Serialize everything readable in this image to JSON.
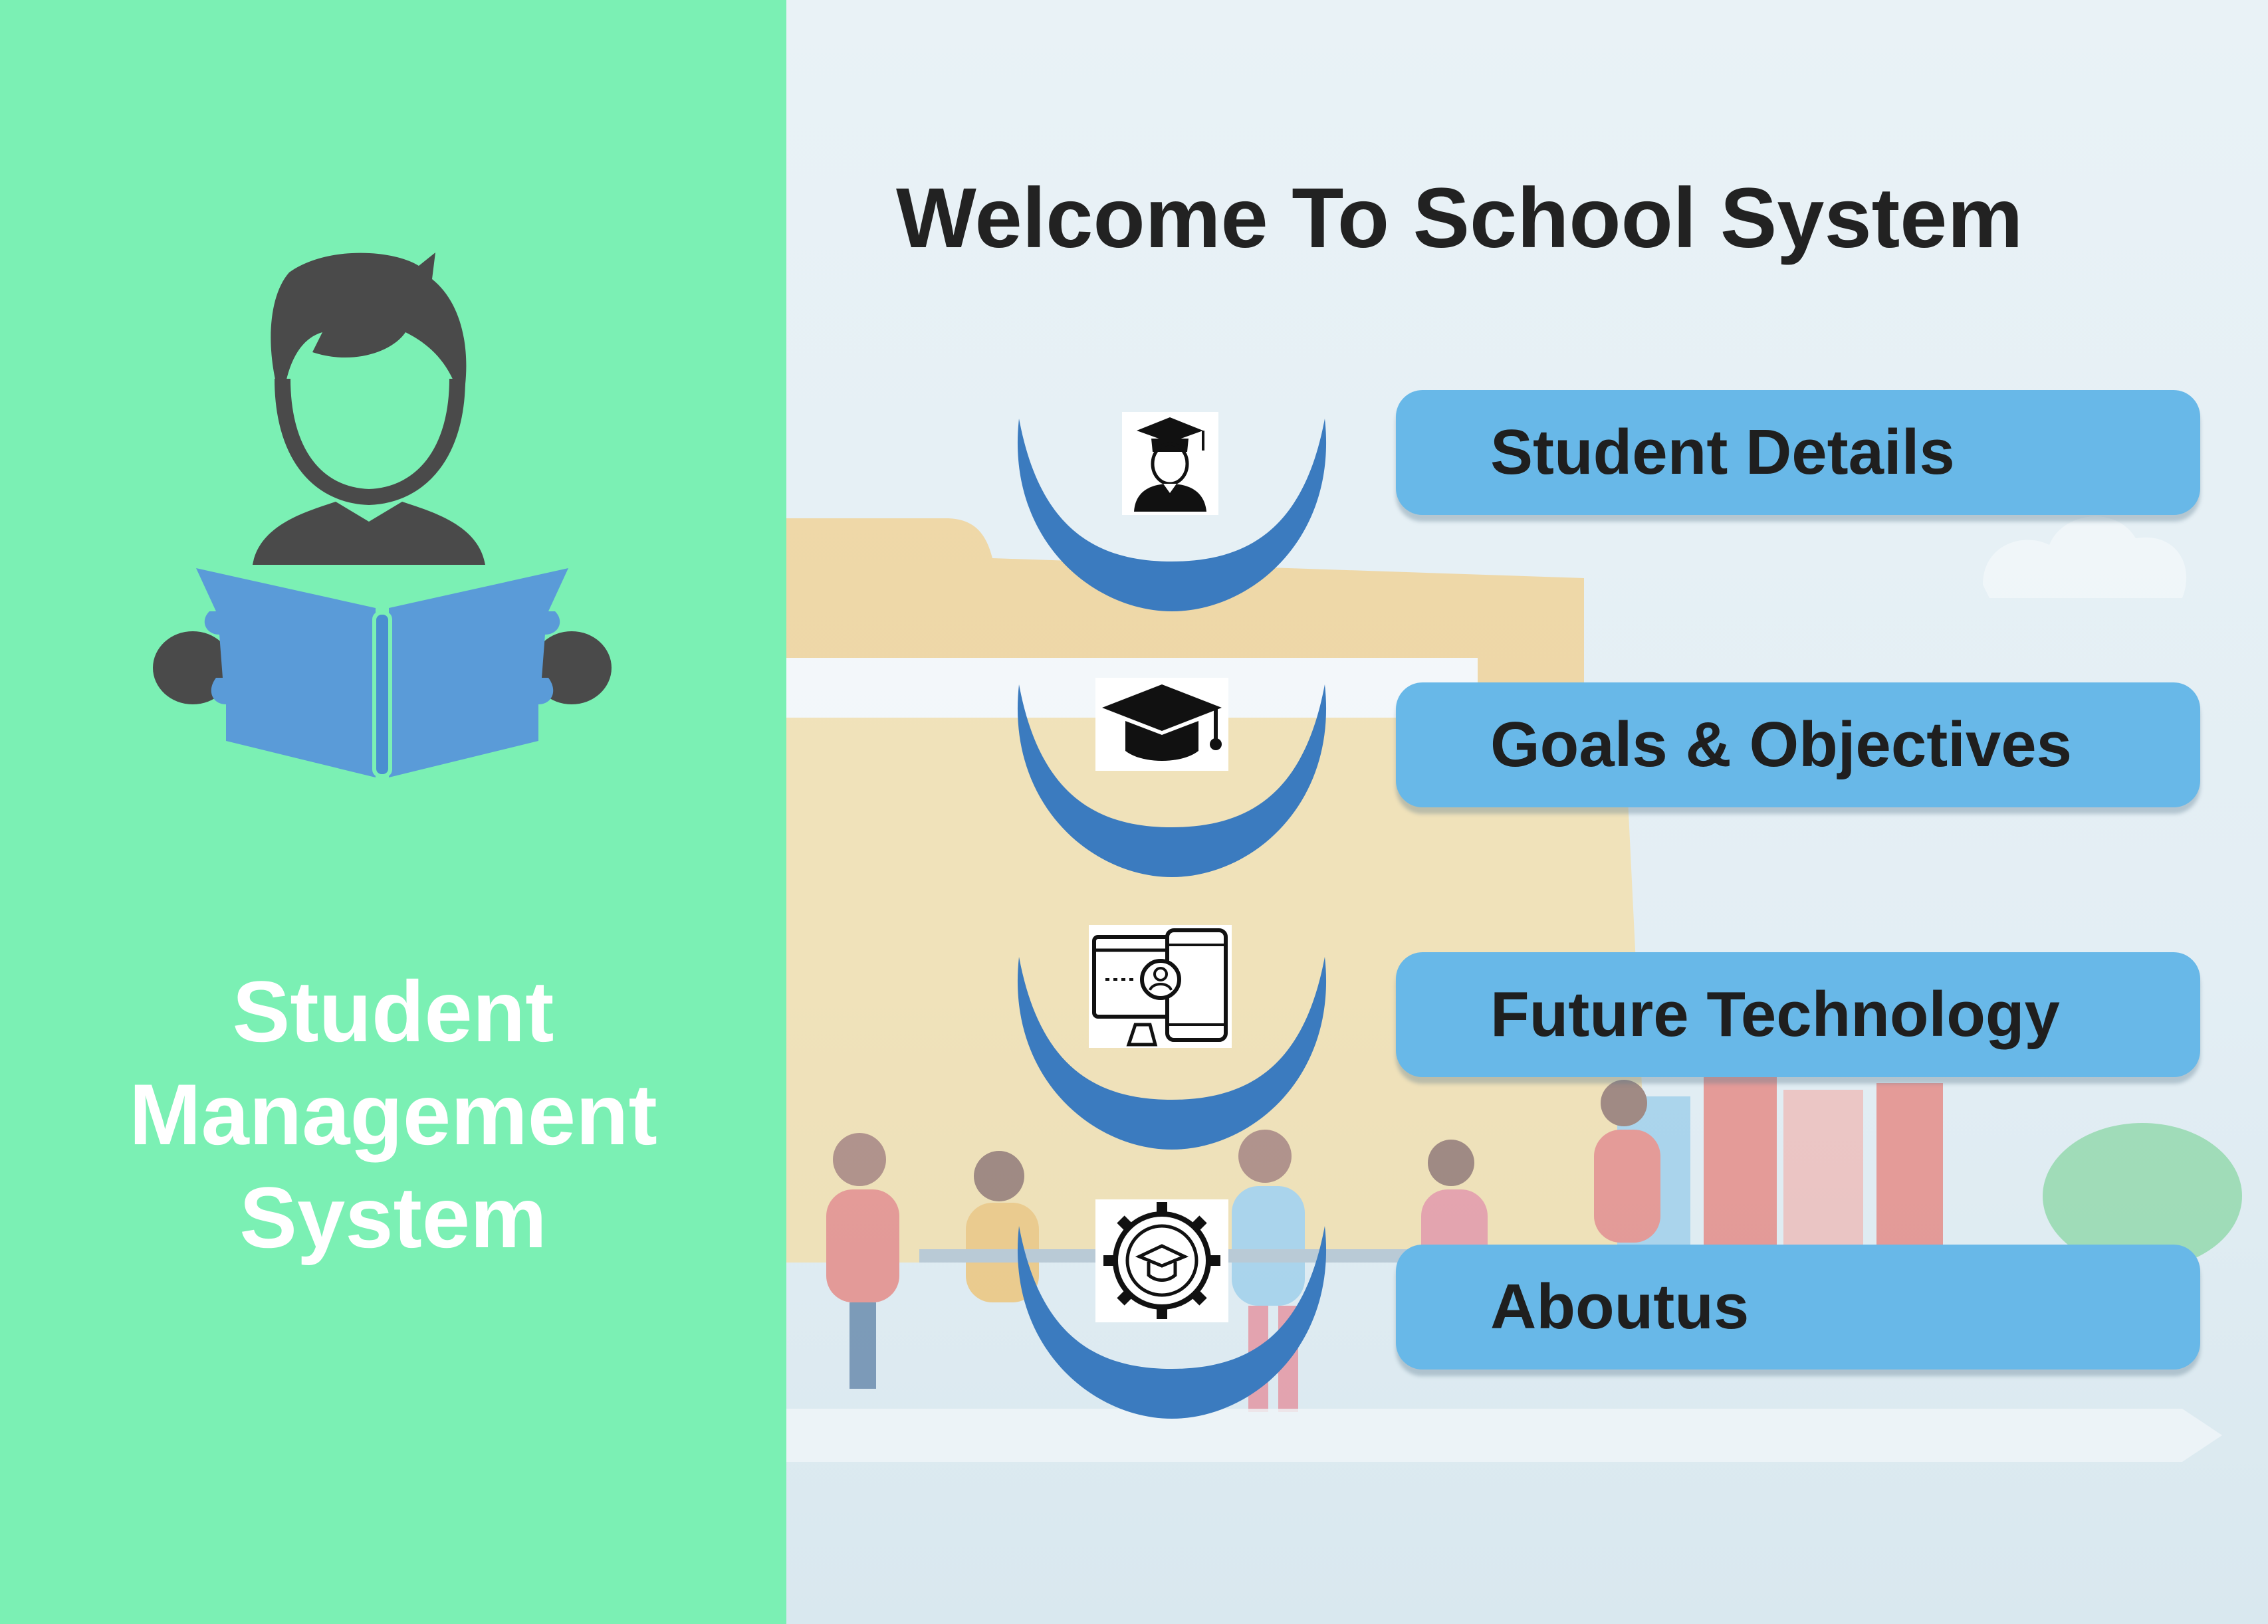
{
  "sidebar": {
    "title_lines": [
      "Student",
      "Management",
      "System"
    ],
    "icon": "student-reading-book-icon"
  },
  "main": {
    "title": "Welcome To School System",
    "menu": [
      {
        "label": "Student Details",
        "icon": "graduate-person-icon"
      },
      {
        "label": "Goals & Objectives",
        "icon": "graduation-cap-icon"
      },
      {
        "label": "Future Technology",
        "icon": "computer-tablet-user-icon"
      },
      {
        "label": "Aboutus",
        "icon": "gear-graduation-cap-icon"
      }
    ]
  },
  "colors": {
    "sidebar_bg": "#7bf0b4",
    "button_bg": "#68b8e8",
    "crescent": "#3b7bbf",
    "icon_dark": "#4a4a4a",
    "book_blue": "#5a9bd8"
  }
}
